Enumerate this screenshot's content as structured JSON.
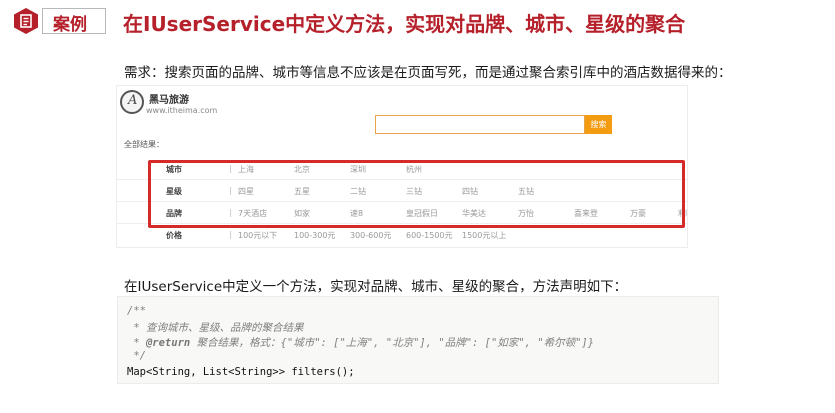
{
  "header": {
    "case_label": "案例",
    "title": "在IUserService中定义方法，实现对品牌、城市、星级的聚合"
  },
  "requirement": "需求：搜索页面的品牌、城市等信息不应该是在页面写死，而是通过聚合索引库中的酒店数据得来的：",
  "screenshot": {
    "brand_name": "黑马旅游",
    "brand_url": "www.itheima.com",
    "search_button": "搜索",
    "all_results": "全部结果：",
    "filters": [
      {
        "label": "城市",
        "items": [
          "上海",
          "北京",
          "深圳",
          "杭州"
        ]
      },
      {
        "label": "星级",
        "items": [
          "四星",
          "五星",
          "二钻",
          "三钻",
          "四钻",
          "五钻"
        ]
      },
      {
        "label": "品牌",
        "items": [
          "7天酒店",
          "如家",
          "速8",
          "皇冠假日",
          "华美达",
          "万怡",
          "喜来登",
          "万豪",
          "和颐"
        ]
      },
      {
        "label": "价格",
        "items": [
          "100元以下",
          "100-300元",
          "300-600元",
          "600-1500元",
          "1500元以上"
        ]
      }
    ]
  },
  "define_text": "在IUserService中定义一个方法，实现对品牌、城市、星级的聚合，方法声明如下：",
  "code": {
    "line1": "/**",
    "line2": " * 查询城市、星级、品牌的聚合结果",
    "line3_tag": "@return",
    "line3_rest": " 聚合结果，格式：{\"城市\": [\"上海\", \"北京\"], \"品牌\": [\"如家\", \"希尔顿\"]}",
    "line4": " */",
    "line5": "Map<String, List<String>> filters();"
  },
  "colors": {
    "accent_red": "#b5202a",
    "highlight_frame": "#d42a2a",
    "search_orange": "#f39c12"
  }
}
